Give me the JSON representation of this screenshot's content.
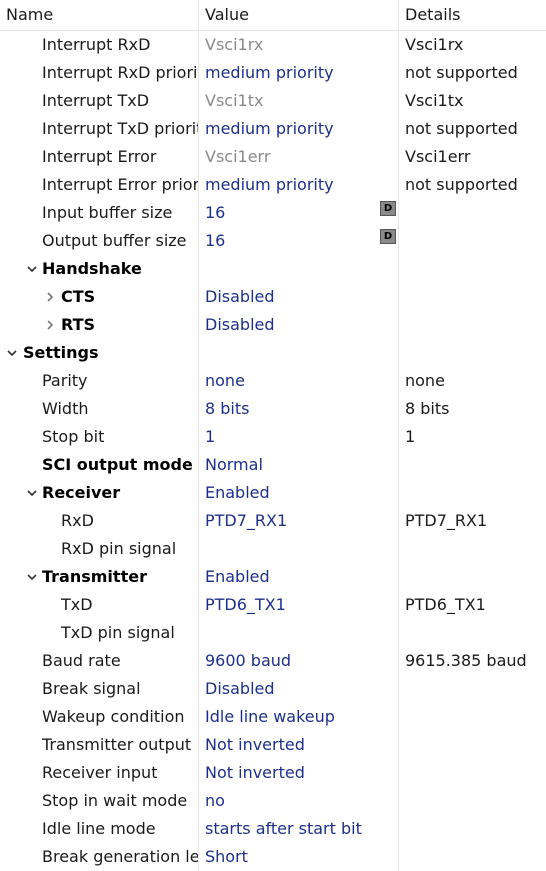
{
  "columns": {
    "name": "Name",
    "value": "Value",
    "details": "Details"
  },
  "rows": [
    {
      "name": "Interrupt RxD",
      "value": "Vsci1rx",
      "details": "Vsci1rx"
    },
    {
      "name": "Interrupt RxD priorit",
      "value": "medium priority",
      "details": "not supported"
    },
    {
      "name": "Interrupt TxD",
      "value": "Vsci1tx",
      "details": "Vsci1tx"
    },
    {
      "name": "Interrupt TxD priorit",
      "value": "medium priority",
      "details": "not supported"
    },
    {
      "name": "Interrupt Error",
      "value": "Vsci1err",
      "details": "Vsci1err"
    },
    {
      "name": "Interrupt Error prior",
      "value": "medium priority",
      "details": "not supported"
    },
    {
      "name": "Input buffer size",
      "value": "16",
      "details": "",
      "badge": "D"
    },
    {
      "name": "Output buffer size",
      "value": "16",
      "details": "",
      "badge": "D"
    },
    {
      "name": "Handshake",
      "value": "",
      "details": ""
    },
    {
      "name": "CTS",
      "value": "Disabled",
      "details": ""
    },
    {
      "name": "RTS",
      "value": "Disabled",
      "details": ""
    },
    {
      "name": "Settings",
      "value": "",
      "details": ""
    },
    {
      "name": "Parity",
      "value": "none",
      "details": "none"
    },
    {
      "name": "Width",
      "value": "8 bits",
      "details": "8 bits"
    },
    {
      "name": "Stop bit",
      "value": "1",
      "details": "1"
    },
    {
      "name": "SCI output mode",
      "value": "Normal",
      "details": ""
    },
    {
      "name": "Receiver",
      "value": "Enabled",
      "details": ""
    },
    {
      "name": "RxD",
      "value": "PTD7_RX1",
      "details": "PTD7_RX1"
    },
    {
      "name": "RxD pin signal",
      "value": "",
      "details": ""
    },
    {
      "name": "Transmitter",
      "value": "Enabled",
      "details": ""
    },
    {
      "name": "TxD",
      "value": "PTD6_TX1",
      "details": "PTD6_TX1"
    },
    {
      "name": "TxD pin signal",
      "value": "",
      "details": ""
    },
    {
      "name": "Baud rate",
      "value": "9600 baud",
      "details": "9615.385 baud"
    },
    {
      "name": "Break signal",
      "value": "Disabled",
      "details": ""
    },
    {
      "name": "Wakeup condition",
      "value": "Idle line wakeup",
      "details": ""
    },
    {
      "name": "Transmitter output",
      "value": "Not inverted",
      "details": ""
    },
    {
      "name": "Receiver input",
      "value": "Not inverted",
      "details": ""
    },
    {
      "name": "Stop in wait mode",
      "value": "no",
      "details": ""
    },
    {
      "name": "Idle line mode",
      "value": "starts after start bit",
      "details": ""
    },
    {
      "name": "Break generation ler",
      "value": "Short",
      "details": ""
    }
  ],
  "colors": {
    "value_text": "#1c2f8a",
    "disabled_text": "#8a8a8a",
    "grid_line": "#e6e6e6"
  },
  "icons": {
    "expanded": "chevron-down-icon",
    "collapsed": "chevron-right-icon",
    "default_badge": "D"
  }
}
